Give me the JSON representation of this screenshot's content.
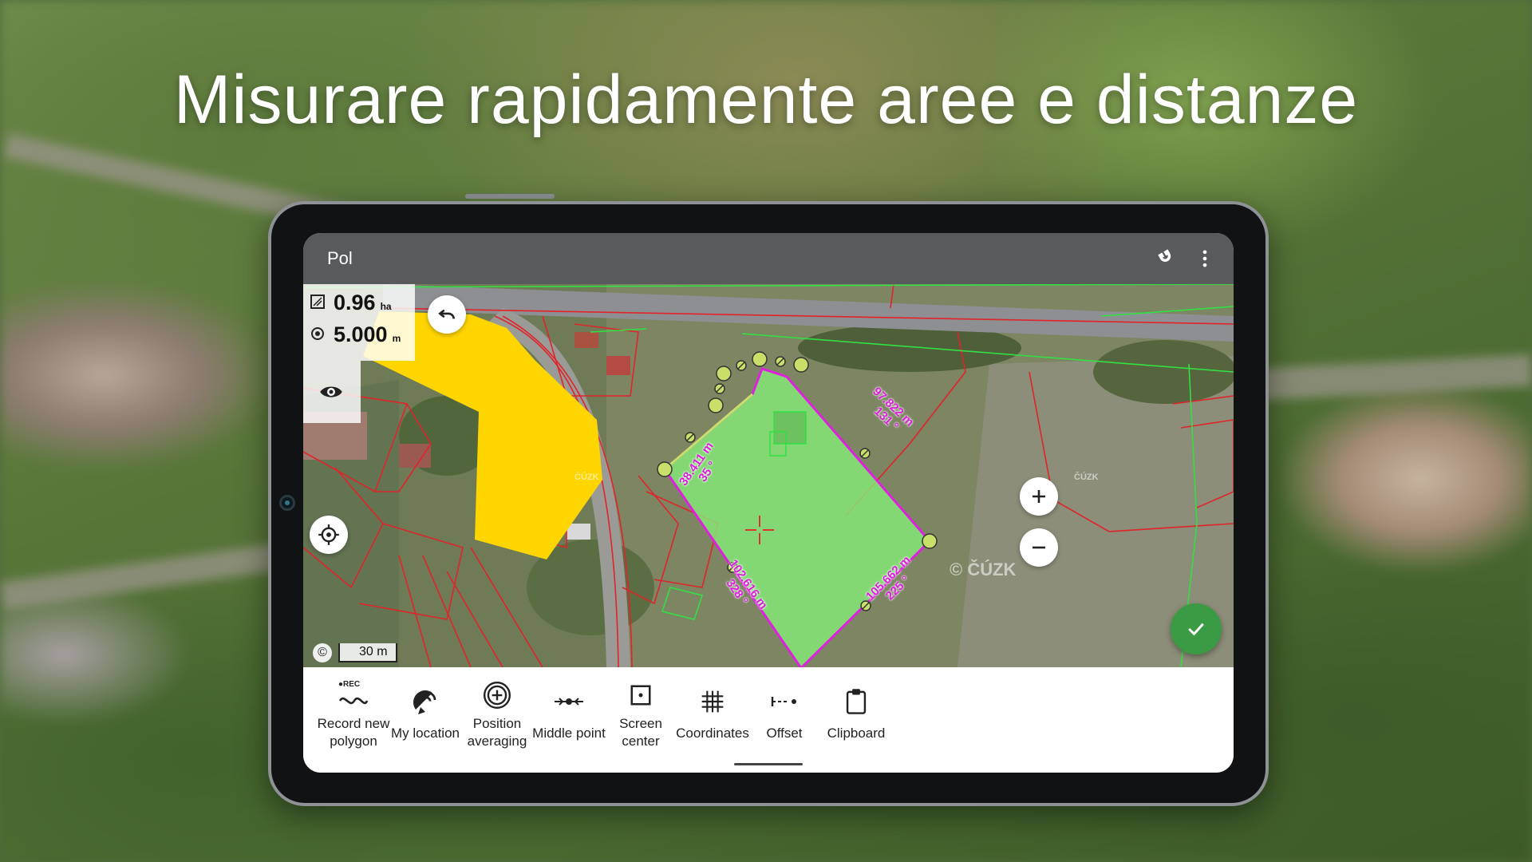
{
  "headline": "Misurare rapidamente aree e distanze",
  "app": {
    "title": "Pol",
    "actions": [
      "magnet-icon",
      "more-vert-icon"
    ]
  },
  "measurements": {
    "area_value": "0.96",
    "area_unit": "ha",
    "perimeter_value": "5.000",
    "perimeter_unit": "m"
  },
  "map": {
    "scale_label": "30 m",
    "attribution_symbol": "©",
    "watermark_large": "© ČÚZK",
    "watermark_small": "ČÚZK",
    "segments": [
      {
        "length": "97.822 m",
        "angle": "131 °"
      },
      {
        "length": "105.662 m",
        "angle": "225 °"
      },
      {
        "length": "102.616 m",
        "angle": "328 °"
      },
      {
        "length": "38.411 m",
        "angle": "35 °"
      }
    ],
    "colors": {
      "polygon_fill": "#7ee07a",
      "polygon_stroke": "#e020e0",
      "other_polygon": "#ffd500",
      "parcel_lines": "#e0242a",
      "vertex": "#c8e06a",
      "confirm": "#3b9b45"
    }
  },
  "toolbar": {
    "items": [
      {
        "icon": "record-icon",
        "rec_badge": "●REC",
        "label_line1": "Record new",
        "label_line2": "polygon"
      },
      {
        "icon": "satellite-icon",
        "label_line1": "My location",
        "label_line2": ""
      },
      {
        "icon": "position-averaging-icon",
        "label_line1": "Position",
        "label_line2": "averaging"
      },
      {
        "icon": "middle-point-icon",
        "label_line1": "Middle point",
        "label_line2": ""
      },
      {
        "icon": "screen-center-icon",
        "label_line1": "Screen",
        "label_line2": "center"
      },
      {
        "icon": "grid-icon",
        "label_line1": "Coordinates",
        "label_line2": ""
      },
      {
        "icon": "offset-icon",
        "label_line1": "Offset",
        "label_line2": ""
      },
      {
        "icon": "clipboard-icon",
        "label_line1": "Clipboard",
        "label_line2": ""
      }
    ]
  }
}
